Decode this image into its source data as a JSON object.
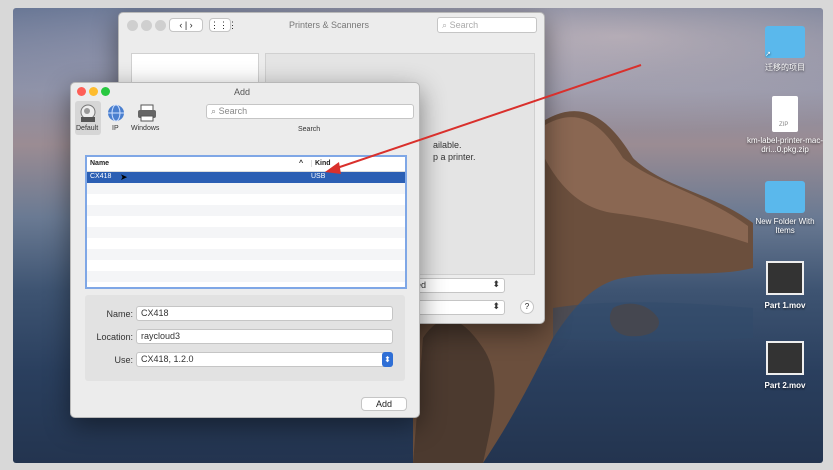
{
  "back_window": {
    "title": "Printers & Scanners",
    "search_placeholder": "Search",
    "message_line1": "ailable.",
    "message_line2": "p a printer.",
    "select1_value": "ed",
    "help_label": "?"
  },
  "add_dialog": {
    "title": "Add",
    "toolbar": {
      "default_label": "Default",
      "ip_label": "IP",
      "windows_label": "Windows",
      "search_placeholder": "Search",
      "search_label": "Search"
    },
    "list": {
      "col_name": "Name",
      "col_kind": "Kind",
      "sort_indicator": "^",
      "rows": [
        {
          "name": "CX418",
          "kind": "USB"
        }
      ]
    },
    "form": {
      "name_label": "Name:",
      "name_value": "CX418",
      "location_label": "Location:",
      "location_value": "raycloud3",
      "use_label": "Use:",
      "use_value": "CX418, 1.2.0"
    },
    "add_button": "Add"
  },
  "desktop": {
    "items": [
      {
        "label": "迁移的项目",
        "icon": "folder-icon"
      },
      {
        "label": "km-label-printer-mac-dri...0.pkg.zip",
        "icon": "zip-file-icon",
        "badge": "ZIP"
      },
      {
        "label": "New Folder With Items",
        "icon": "folder-icon"
      },
      {
        "label": "Part 1.mov",
        "icon": "video-file-icon"
      },
      {
        "label": "Part 2.mov",
        "icon": "video-file-icon"
      }
    ]
  },
  "colors": {
    "close": "#fe5f57",
    "minimize": "#febc2e",
    "zoom": "#28c840",
    "selection": "#2b5fb4",
    "focus_ring": "#7fa7e6",
    "annotation_arrow": "#d9302c",
    "folder": "#5ab8ec"
  }
}
